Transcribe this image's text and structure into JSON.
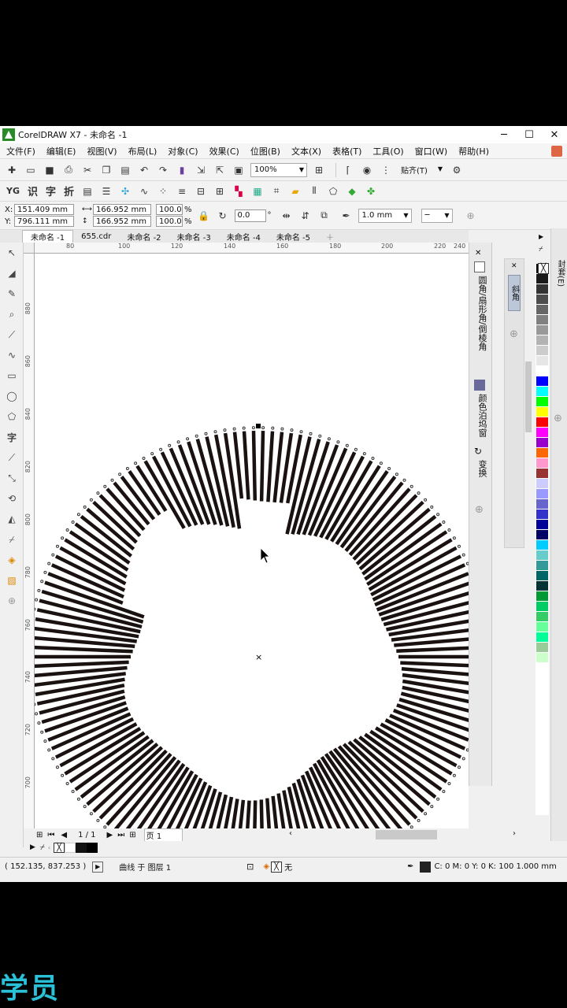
{
  "window": {
    "title": "CorelDRAW X7 - 未命名 -1",
    "minimize": "─",
    "maximize": "☐",
    "close": "✕"
  },
  "menu": [
    "文件(F)",
    "编辑(E)",
    "视图(V)",
    "布局(L)",
    "对象(C)",
    "效果(C)",
    "位图(B)",
    "文本(X)",
    "表格(T)",
    "工具(O)",
    "窗口(W)",
    "帮助(H)"
  ],
  "toolbar": {
    "zoom": "100%",
    "snap": "贴齐(T)"
  },
  "toolbar2": {
    "t1": "识",
    "t2": "字",
    "t3": "折"
  },
  "propbar": {
    "x": "151.409 mm",
    "y": "796.111 mm",
    "w": "166.952 mm",
    "h": "166.952 mm",
    "sx": "100.0",
    "sy": "100.0",
    "pct": "%",
    "x_label": "X:",
    "y_label": "Y:",
    "angle": "0.0",
    "deg": "°",
    "outline": "1.0 mm"
  },
  "tabs": [
    "未命名 -1",
    "655.cdr",
    "未命名 -2",
    "未命名 -3",
    "未命名 -4",
    "未命名 -5"
  ],
  "hruler": [
    "80",
    "100",
    "120",
    "140",
    "160",
    "180",
    "200",
    "220",
    "240"
  ],
  "hruler_unit": "毫米",
  "vruler": [
    "880",
    "860",
    "840",
    "820",
    "800",
    "780",
    "760",
    "740",
    "720",
    "700"
  ],
  "vruler_unit": "毫米",
  "docker": {
    "round": "圆角/扇形角/倒棱角",
    "color": "颜色泊坞窗",
    "transform": "变换"
  },
  "docker2": {
    "bevel": "斜角"
  },
  "right_tab": "封套(E)",
  "pagebar": {
    "counter": "1 / 1",
    "page": "页 1"
  },
  "statusbar": {
    "coords": "( 152.135, 837.253 )",
    "info": "曲线 于 图层 1",
    "fill": "无",
    "outline_info": "C: 0 M: 0 Y: 0 K: 100  1.000 mm"
  },
  "palette": [
    "#000000",
    "#1a1a1a",
    "#333333",
    "#4d4d4d",
    "#666666",
    "#808080",
    "#999999",
    "#b3b3b3",
    "#cccccc",
    "#e6e6e6",
    "#ffffff",
    "#0000ff",
    "#00ffff",
    "#00ff00",
    "#ffff00",
    "#ff0000",
    "#ff00ff",
    "#9900cc",
    "#ff6600",
    "#ff99cc",
    "#993333",
    "#ccccff",
    "#9999ff",
    "#6666cc",
    "#3333cc",
    "#000099",
    "#000066",
    "#00ccff",
    "#66cccc",
    "#339999",
    "#006666",
    "#003333",
    "#009933",
    "#00cc66",
    "#33cc66",
    "#66ff99",
    "#00ff99",
    "#99cc99",
    "#ccffcc"
  ],
  "watermark": "学员"
}
